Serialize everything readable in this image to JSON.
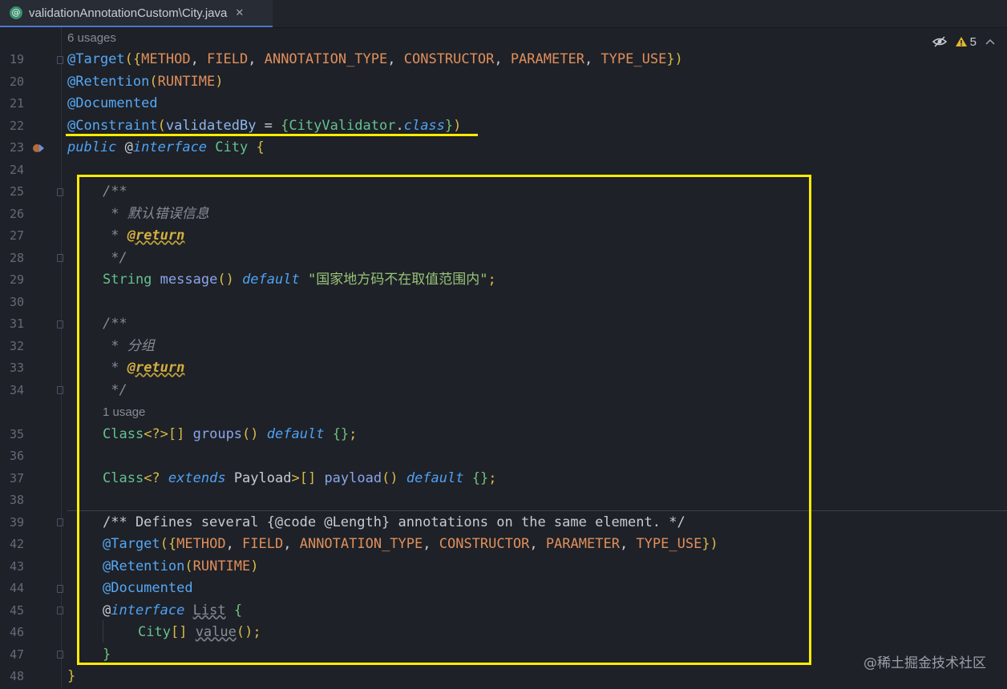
{
  "tab": {
    "icon_glyph": "@",
    "label": "validationAnnotationCustom\\City.java",
    "close_glyph": "✕"
  },
  "toolbar": {
    "warnings_count": "5",
    "icons": [
      "eye-off-icon",
      "warning-icon",
      "chevron-up-icon"
    ]
  },
  "hints": {
    "usages_top": "6 usages",
    "usages_groups": "1 usage"
  },
  "gutter": {
    "lines": [
      "19",
      "20",
      "21",
      "22",
      "23",
      "24",
      "25",
      "26",
      "27",
      "28",
      "29",
      "30",
      "31",
      "32",
      "33",
      "34",
      "35",
      "36",
      "37",
      "38",
      "39",
      "42",
      "43",
      "44",
      "45",
      "46",
      "47",
      "48"
    ]
  },
  "code": {
    "l19": {
      "at": "@Target",
      "p1": "({",
      "a": "METHOD",
      "c1": ", ",
      "b": "FIELD",
      "c2": ", ",
      "c": "ANNOTATION_TYPE",
      "c3": ", ",
      "d": "CONSTRUCTOR",
      "c4": ", ",
      "e": "PARAMETER",
      "c5": ", ",
      "f": "TYPE_USE",
      "p2": "})"
    },
    "l20": {
      "at": "@Retention",
      "p1": "(",
      "a": "RUNTIME",
      "p2": ")"
    },
    "l21": {
      "at": "@Documented"
    },
    "l22": {
      "at": "@Constraint",
      "p1": "(",
      "param": "validatedBy",
      "eq": " = ",
      "b1": "{",
      "cls": "CityValidator",
      "dot": ".",
      "kw": "class",
      "b2": "}",
      "p2": ")"
    },
    "l23": {
      "kw": "public",
      "sp": " ",
      "at": "@",
      "kw2": "interface",
      "name": " City ",
      "brace": "{"
    },
    "l25": {
      "text": "/**"
    },
    "l26": {
      "text": " * 默认错误信息"
    },
    "l27": {
      "star": " * ",
      "tag": "@return"
    },
    "l28": {
      "text": " */"
    },
    "l29": {
      "type": "String",
      "sp": " ",
      "fn": "message",
      "par": "()",
      "sp2": " ",
      "kw": "default",
      "sp3": " ",
      "str": "\"国家地方码不在取值范围内\"",
      "semi": ";"
    },
    "l31": {
      "text": "/**"
    },
    "l32": {
      "text": " * 分组"
    },
    "l33": {
      "star": " * ",
      "tag": "@return"
    },
    "l34": {
      "text": " */"
    },
    "l35": {
      "type": "Class",
      "gen": "<?>[]",
      "sp": " ",
      "fn": "groups",
      "par": "()",
      "sp2": " ",
      "kw": "default",
      "sp3": " ",
      "br": "{}",
      "semi": ";"
    },
    "l37": {
      "type": "Class",
      "gen1": "<? ",
      "kw1": "extends",
      "sp": " ",
      "t2": "Payload",
      "gen2": ">[]",
      "sp2": " ",
      "fn": "payload",
      "par": "()",
      "sp3": " ",
      "kw": "default",
      "sp4": " ",
      "br": "{}",
      "semi": ";"
    },
    "l39": {
      "text": "/** Defines several {@code @Length} annotations on the same element. */"
    },
    "l42": {
      "at": "@Target",
      "p1": "({",
      "a": "METHOD",
      "c1": ", ",
      "b": "FIELD",
      "c2": ", ",
      "c": "ANNOTATION_TYPE",
      "c3": ", ",
      "d": "CONSTRUCTOR",
      "c4": ", ",
      "e": "PARAMETER",
      "c5": ", ",
      "f": "TYPE_USE",
      "p2": "})"
    },
    "l43": {
      "at": "@Retention",
      "p1": "(",
      "a": "RUNTIME",
      "p2": ")"
    },
    "l44": {
      "at": "@Documented"
    },
    "l45": {
      "at": "@",
      "kw": "interface",
      "sp": " ",
      "name": "List",
      "sp2": " ",
      "brace": "{"
    },
    "l46": {
      "type": "City",
      "gen": "[]",
      "sp": " ",
      "fn": "value",
      "par": "()",
      "semi": ";"
    },
    "l47": {
      "brace": "}"
    },
    "l48": {
      "brace": "}"
    }
  },
  "watermark": "@稀土掘金技术社区"
}
